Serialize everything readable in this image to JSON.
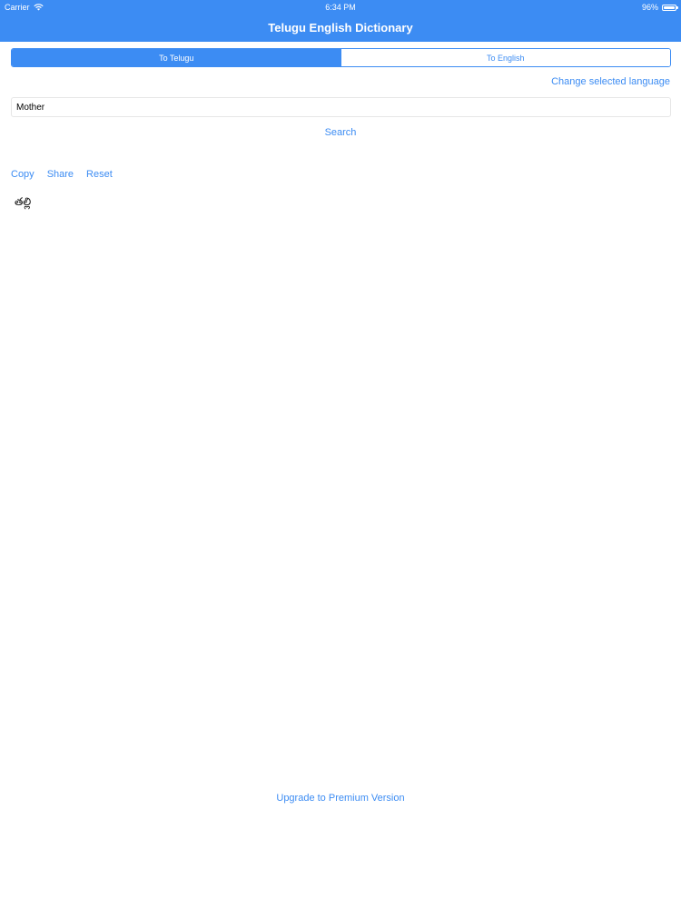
{
  "status_bar": {
    "carrier": "Carrier",
    "time": "6:34 PM",
    "battery_text": "96%",
    "battery_level": 0.96
  },
  "header": {
    "title": "Telugu English Dictionary"
  },
  "segmented_control": {
    "segments": [
      {
        "label": "To Telugu",
        "selected": true
      },
      {
        "label": "To English",
        "selected": false
      }
    ]
  },
  "change_language_label": "Change selected language",
  "search": {
    "value": "Mother",
    "button_label": "Search"
  },
  "actions": {
    "copy_label": "Copy",
    "share_label": "Share",
    "reset_label": "Reset"
  },
  "result": {
    "text": "తల్లి"
  },
  "upgrade_label": "Upgrade to Premium Version",
  "colors": {
    "accent": "#3c8cf3",
    "background": "#ffffff"
  }
}
